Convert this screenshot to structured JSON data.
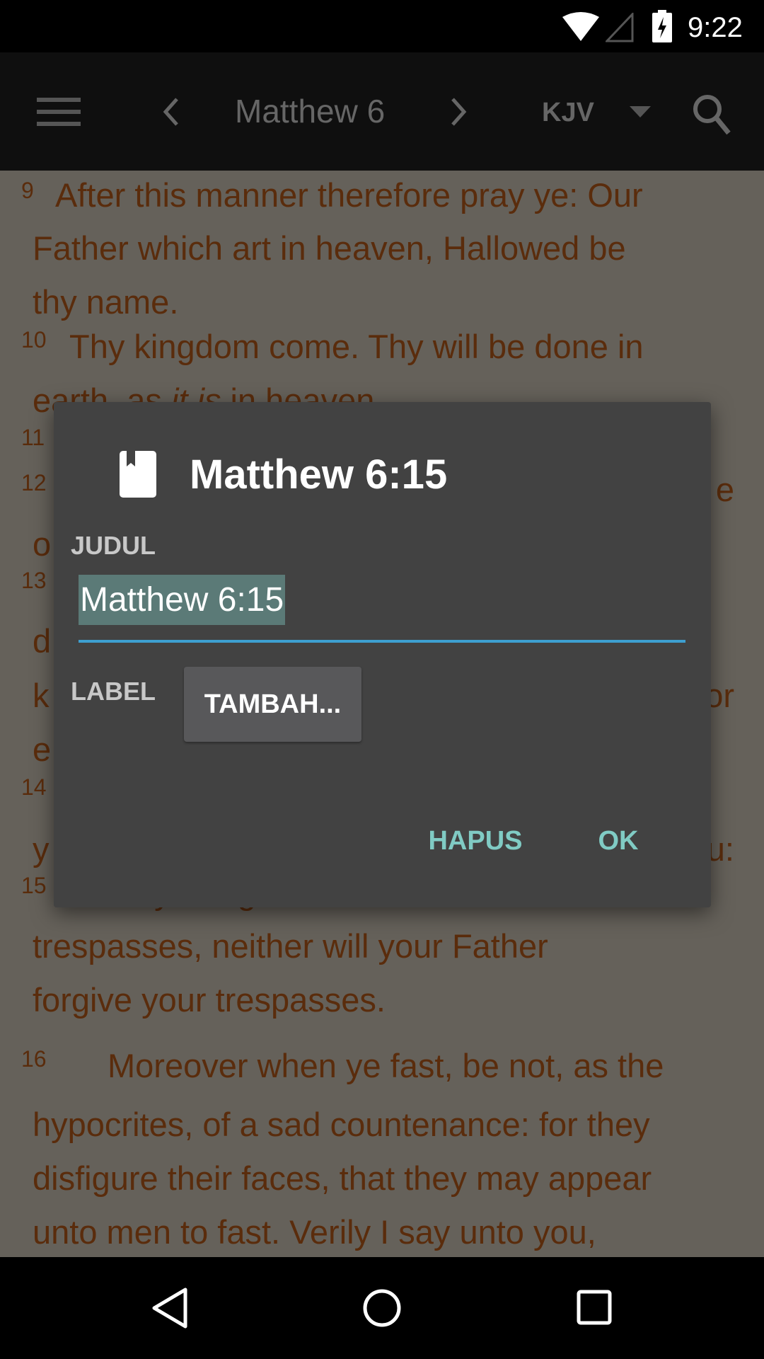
{
  "status_bar": {
    "time": "9:22",
    "icons": [
      "wifi-icon",
      "signal-icon",
      "battery-charging-icon"
    ]
  },
  "toolbar": {
    "menu_icon": "menu-icon",
    "prev_icon": "chevron-left-icon",
    "title": "Matthew 6",
    "next_icon": "chevron-right-icon",
    "version": "KJV",
    "dropdown_icon": "dropdown-icon",
    "search_icon": "search-icon"
  },
  "content": {
    "v9_num": "9",
    "v9_l1": "After this manner therefore pray ye: Our",
    "v9_l2": "Father which art in heaven, Hallowed be",
    "v9_l3": "thy name.",
    "v10_num": "10",
    "v10_l1": "Thy kingdom come. Thy will be done in",
    "v10_l2a": "earth, as ",
    "v10_l2b": "it is",
    "v10_l2c": " in heaven.",
    "v11_num": "11",
    "v12_num": "12",
    "frag_12_end": "e",
    "frag_o": "o",
    "v13_num": "13",
    "frag_d": "d",
    "frag_k": "k",
    "frag_or": "or",
    "frag_e": "e",
    "v14_num": "14",
    "frag_y": "y",
    "frag_u": "u:",
    "v15_num": "15",
    "v15_l1": "But if ye forgive not men their",
    "v15_l2": "trespasses, neither will your Father",
    "v15_l3": "forgive your trespasses.",
    "v16_num": "16",
    "v16_l1": "Moreover when ye fast, be not, as the",
    "v16_l2": "hypocrites, of a sad countenance: for they",
    "v16_l3": "disfigure their faces, that they may appear",
    "v16_l4": "unto men to fast. Verily I say unto you,"
  },
  "dialog": {
    "icon": "bookmark-book-icon",
    "title": "Matthew 6:15",
    "title_label": "JUDUL",
    "title_value": "Matthew 6:15",
    "label_label": "LABEL",
    "add_button": "TAMBAH...",
    "delete_button": "HAPUS",
    "ok_button": "OK"
  },
  "navbar": {
    "back": "back-icon",
    "home": "home-icon",
    "recents": "recents-icon"
  },
  "colors": {
    "accent": "#80cbc4",
    "underline": "#3d9fd0",
    "selection": "#5b7a77",
    "dialog_bg": "#424242",
    "text": "#5a2c0c"
  }
}
